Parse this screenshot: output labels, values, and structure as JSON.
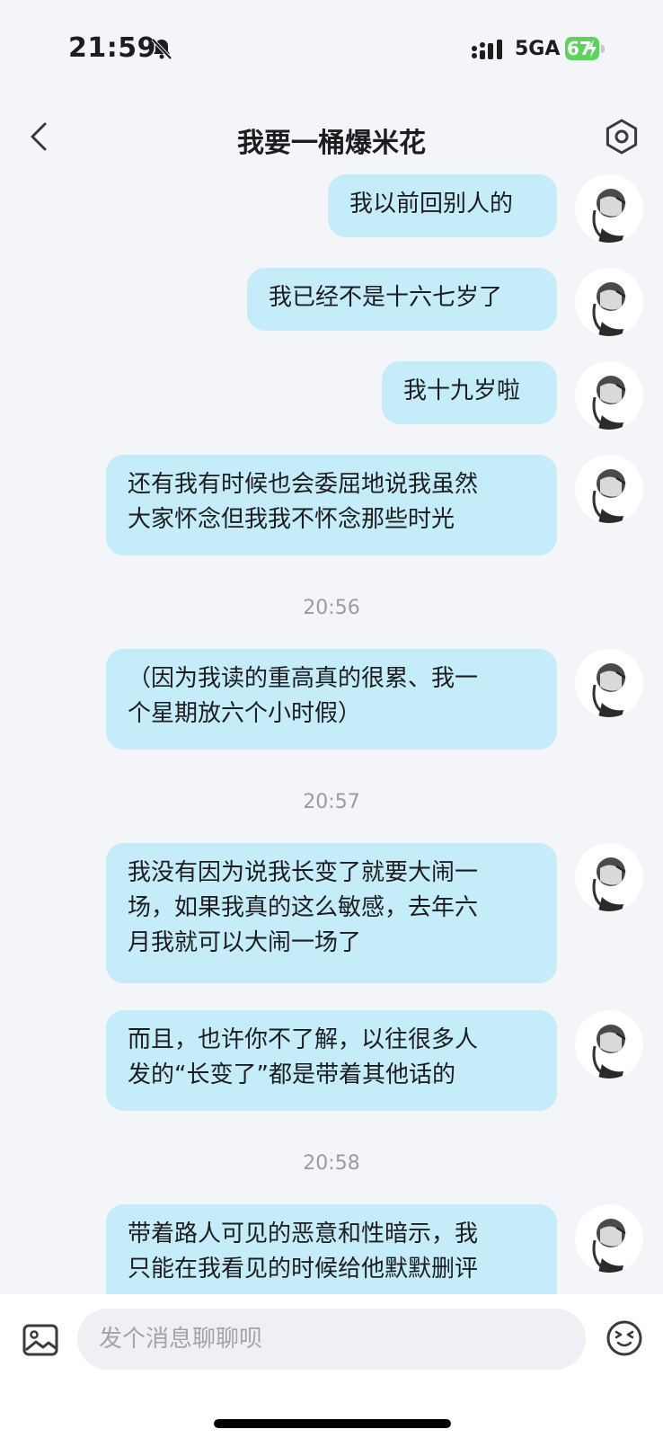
{
  "status": {
    "time": "21:59",
    "network": "5GA",
    "battery": "67"
  },
  "header": {
    "title": "我要一桶爆米花"
  },
  "messages": [
    {
      "text": "我以前回别人的"
    },
    {
      "text": "我已经不是十六七岁了"
    },
    {
      "text": "我十九岁啦"
    },
    {
      "text": "还有我有时候也会委屈地说我虽然\n大家怀念但我我不怀念那些时光"
    },
    {
      "text": "（因为我读的重高真的很累、我一\n个星期放六个小时假）"
    },
    {
      "text": "我没有因为说我长变了就要大闹一\n场，如果我真的这么敏感，去年六\n月我就可以大闹一场了"
    },
    {
      "text": "而且，也许你不了解，以往很多人\n发的“长变了”都是带着其他话的"
    },
    {
      "text": "带着路人可见的恶意和性暗示，我\n只能在我看见的时候给他默默删评"
    }
  ],
  "timestamps": [
    "20:56",
    "20:57",
    "20:58"
  ],
  "composer": {
    "placeholder": "发个消息聊聊呗"
  },
  "colors": {
    "bubble": "#c4ecf9",
    "background": "#f4f5f8",
    "battery": "#5bd45d"
  }
}
